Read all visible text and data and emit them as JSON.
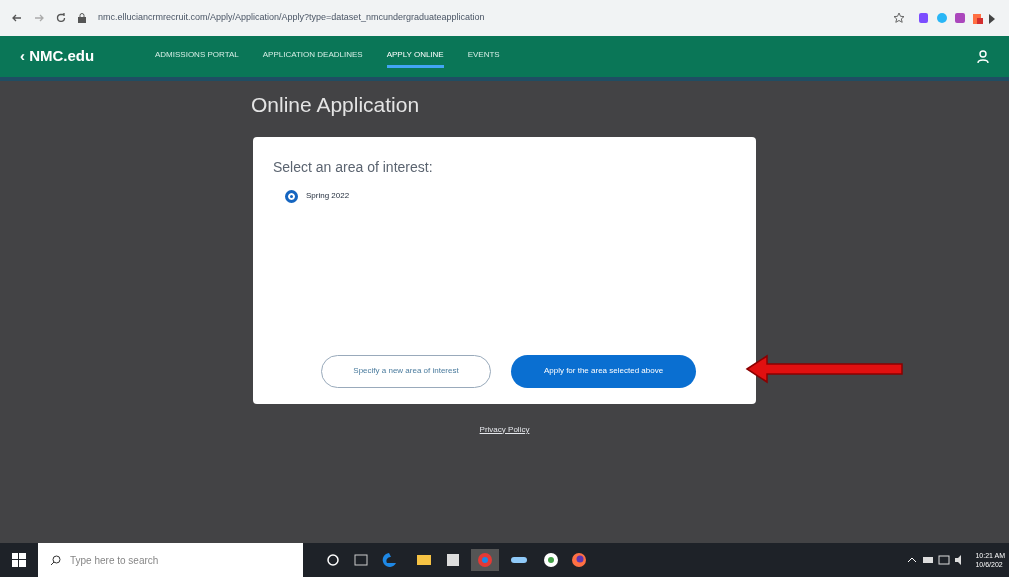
{
  "browser": {
    "url": "nmc.elluciancrmrecruit.com/Apply/Application/Apply?type=dataset_nmcundergraduateapplication"
  },
  "nav": {
    "brand": "‹ NMC.edu",
    "items": [
      {
        "label": "ADMISSIONS PORTAL",
        "selected": false
      },
      {
        "label": "APPLICATION DEADLINES",
        "selected": false
      },
      {
        "label": "APPLY ONLINE",
        "selected": true
      },
      {
        "label": "EVENTS",
        "selected": false
      }
    ]
  },
  "page": {
    "title": "Online Application",
    "prompt": "Select an area of interest:",
    "options": [
      {
        "label": "Spring 2022",
        "selected": true
      }
    ],
    "buttons": [
      {
        "label": "Specify a new area of interest",
        "kind": "outline"
      },
      {
        "label": "Apply for the area selected above",
        "kind": "primary"
      }
    ],
    "footer_link": "Privacy Policy"
  },
  "taskbar": {
    "search_placeholder": "Type here to search",
    "time": "10:21 AM",
    "date": "10/6/202"
  }
}
